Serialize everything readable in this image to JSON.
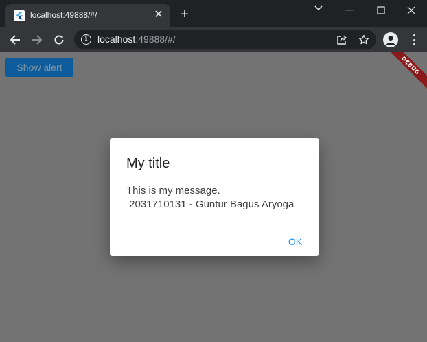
{
  "browser": {
    "tab_title": "localhost:49888/#/",
    "url_host": "localhost",
    "url_rest": ":49888/#/"
  },
  "page": {
    "show_alert_label": "Show alert",
    "debug_banner": "DEBUG"
  },
  "dialog": {
    "title": "My title",
    "message_line1": "This is my message.",
    "message_line2": " 2031710131 - Guntur Bagus Aryoga",
    "ok_label": "OK"
  },
  "icons": {
    "tab_favicon": "flutter-icon",
    "tab_close": "close-icon",
    "new_tab": "plus-icon",
    "tab_search": "chevron-down-icon",
    "minimize": "minimize-icon",
    "maximize": "maximize-icon",
    "close_window": "close-icon",
    "back": "arrow-left-icon",
    "forward": "arrow-right-icon",
    "reload": "reload-icon",
    "site_info": "info-icon",
    "share": "share-icon",
    "bookmark": "star-icon",
    "profile": "profile-icon",
    "menu": "kebab-menu-icon"
  },
  "colors": {
    "scrim": "#737373",
    "button_bg": "#0d5b9a",
    "ok_text": "#2196f3",
    "debug_banner": "#8b1a1a"
  }
}
